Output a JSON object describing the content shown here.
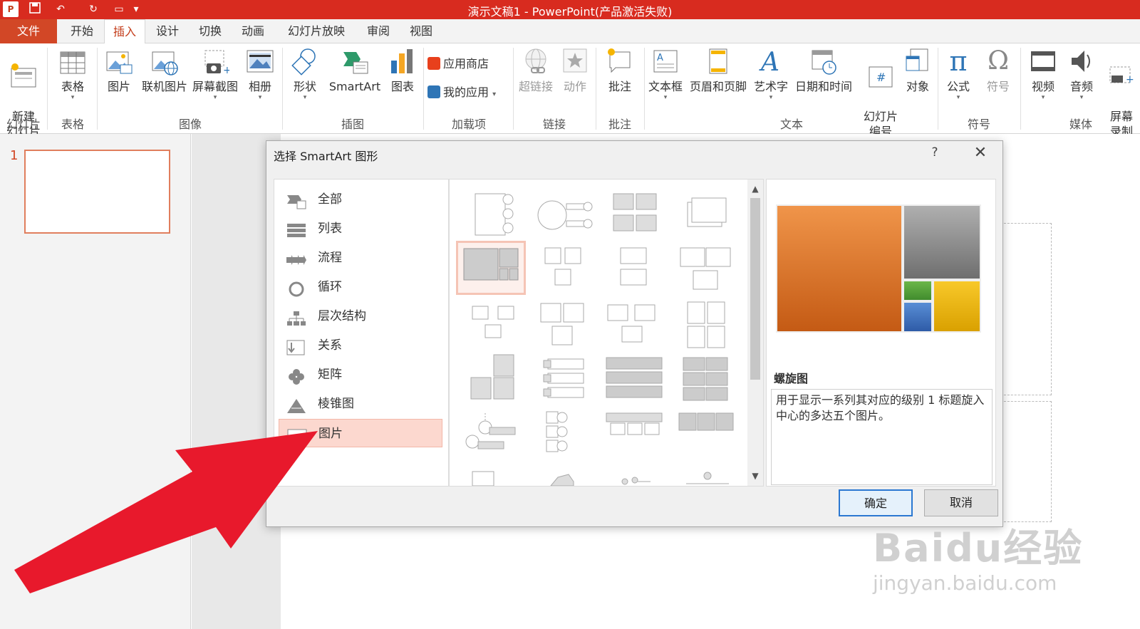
{
  "titlebar": {
    "title": "演示文稿1 -  PowerPoint(产品激活失败)",
    "logo_text": "P",
    "color": "#d82b1f"
  },
  "tabs": [
    {
      "label": "文件"
    },
    {
      "label": "开始"
    },
    {
      "label": "插入"
    },
    {
      "label": "设计"
    },
    {
      "label": "切换"
    },
    {
      "label": "动画"
    },
    {
      "label": "幻灯片放映"
    },
    {
      "label": "审阅"
    },
    {
      "label": "视图"
    }
  ],
  "ribbon": {
    "buttons": {
      "new_slide": "新建\n幻灯片",
      "table": "表格",
      "picture": "图片",
      "online_picture": "联机图片",
      "screenshot": "屏幕截图",
      "album": "相册",
      "shapes": "形状",
      "smartart": "SmartArt",
      "chart": "图表",
      "store": "应用商店",
      "my_apps": "我的应用",
      "hyperlink": "超链接",
      "action": "动作",
      "comment": "批注",
      "textbox": "文本框",
      "header_footer": "页眉和页脚",
      "wordart": "艺术字",
      "datetime": "日期和时间",
      "slide_number": "幻灯片\n编号",
      "object": "对象",
      "equation": "公式",
      "symbol": "符号",
      "video": "视频",
      "audio": "音频",
      "screen_record": "屏幕\n录制"
    },
    "groups": {
      "slides": "幻灯片",
      "tables": "表格",
      "images": "图像",
      "illustrations": "插图",
      "addins": "加载项",
      "links": "链接",
      "comments": "批注",
      "text": "文本",
      "symbols": "符号",
      "media": "媒体"
    }
  },
  "slidepane": {
    "number": "1"
  },
  "dialog": {
    "title": "选择 SmartArt 图形",
    "help": "?",
    "close": "✕",
    "categories": [
      {
        "label": "全部"
      },
      {
        "label": "列表"
      },
      {
        "label": "流程"
      },
      {
        "label": "循环"
      },
      {
        "label": "层次结构"
      },
      {
        "label": "关系"
      },
      {
        "label": "矩阵"
      },
      {
        "label": "棱锥图"
      },
      {
        "label": "图片"
      }
    ],
    "selected_category": "图片",
    "preview": {
      "name": "螺旋图",
      "description": "用于显示一系列其对应的级别 1 标题旋入中心的多达五个图片。"
    },
    "ok_label": "确定",
    "cancel_label": "取消"
  },
  "watermark": {
    "brand": "Baidu经验",
    "url": "jingyan.baidu.com"
  }
}
